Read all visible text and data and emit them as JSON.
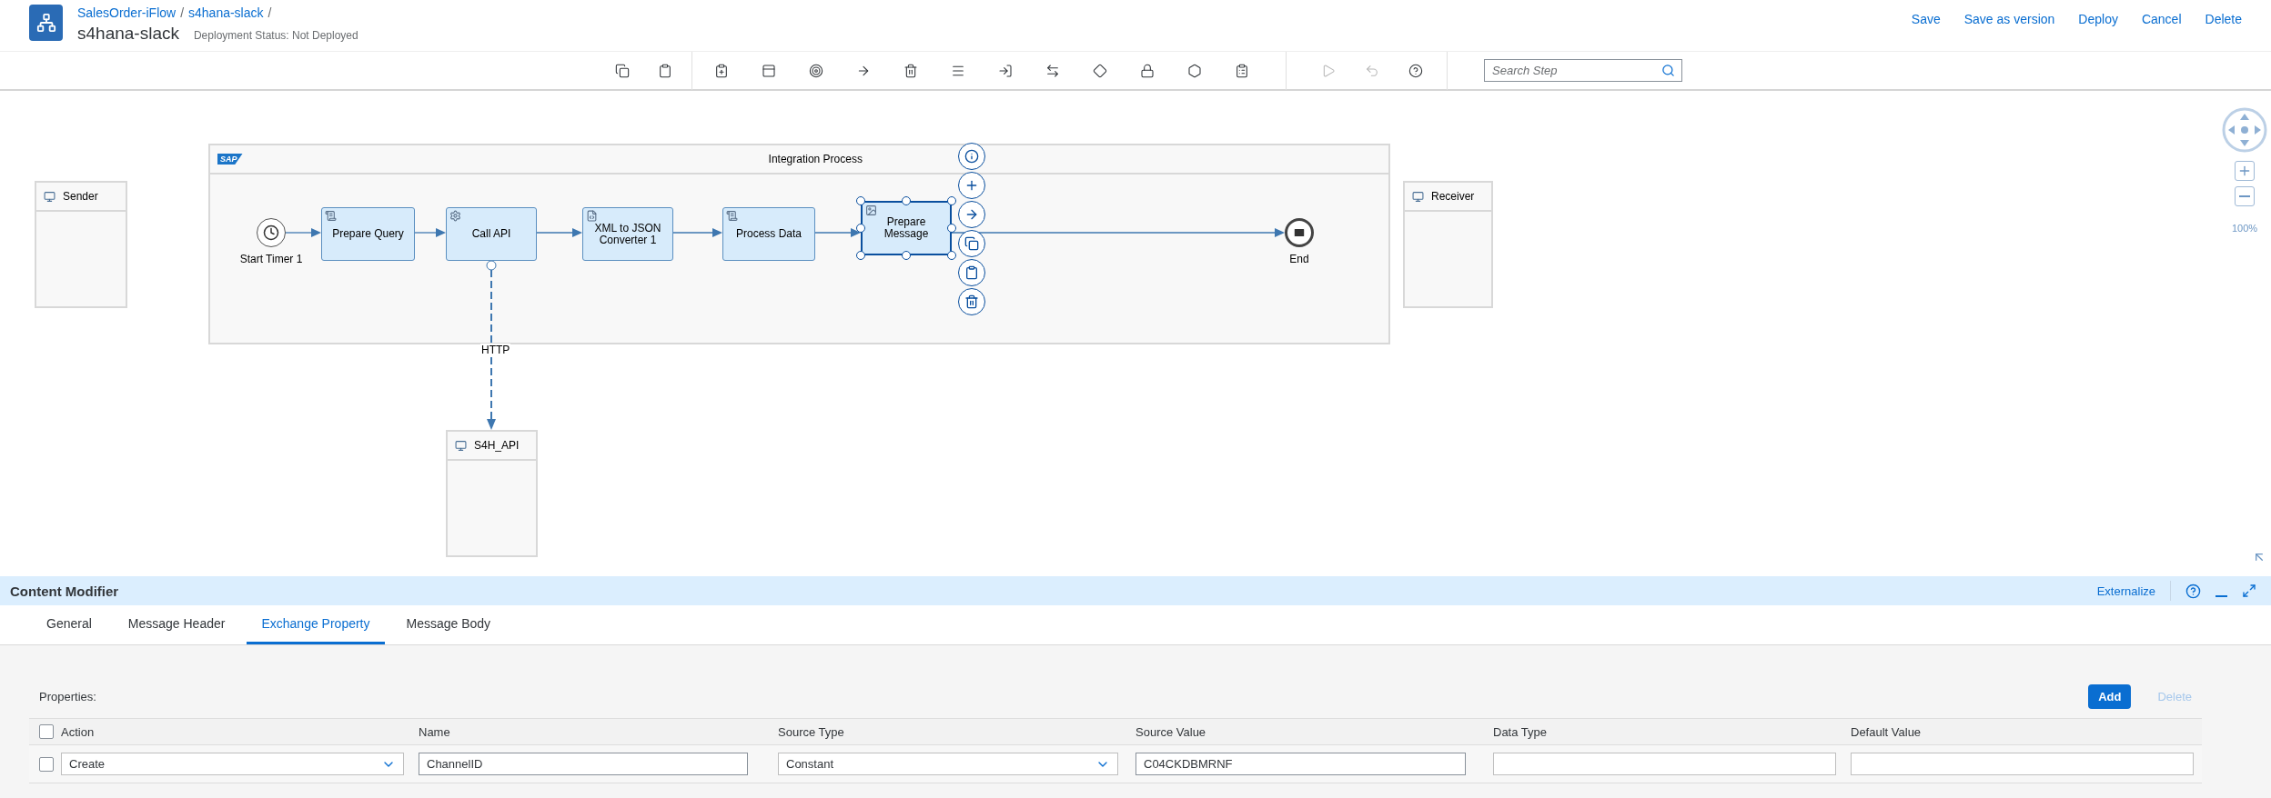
{
  "header": {
    "breadcrumbs": [
      "SalesOrder-iFlow",
      "s4hana-slack"
    ],
    "separator": "/",
    "title": "s4hana-slack",
    "status": "Deployment Status: Not Deployed",
    "actions": [
      "Save",
      "Save as version",
      "Deploy",
      "Cancel",
      "Delete"
    ]
  },
  "toolbar": {
    "tools": [
      {
        "disabled": false
      },
      {
        "disabled": false
      },
      {
        "disabled": false
      },
      {
        "disabled": false
      },
      {
        "disabled": false
      },
      {
        "disabled": false
      },
      {
        "disabled": false
      },
      {
        "disabled": false
      },
      {
        "disabled": false
      },
      {
        "disabled": false
      },
      {
        "disabled": false
      },
      {
        "disabled": false
      },
      {
        "disabled": false
      },
      {
        "disabled": false
      },
      {
        "disabled": true
      },
      {
        "disabled": true
      },
      {
        "disabled": false
      }
    ],
    "search": {
      "placeholder": "Search Step"
    }
  },
  "canvas": {
    "participants": [
      {
        "name": "Sender"
      },
      {
        "name": "Receiver"
      },
      {
        "name": "S4H_API"
      }
    ],
    "process": {
      "title": "Integration Process",
      "logo": "SAP",
      "steps": [
        {
          "kind": "timer",
          "label": "Start Timer 1",
          "selected": false
        },
        {
          "kind": "script",
          "label": "Prepare Query",
          "selected": false
        },
        {
          "kind": "service",
          "label": "Call API",
          "selected": false
        },
        {
          "kind": "converter",
          "label": "XML to JSON Converter 1",
          "selected": false
        },
        {
          "kind": "script",
          "label": "Process Data",
          "selected": false
        },
        {
          "kind": "modifier",
          "label": "Prepare Message",
          "selected": true
        },
        {
          "kind": "end",
          "label": "End",
          "selected": false
        }
      ]
    },
    "connection": {
      "label": "HTTP"
    },
    "zoom": "100%"
  },
  "panel": {
    "title": "Content Modifier",
    "actions": [
      "Externalize"
    ],
    "tabs": [
      {
        "label": "General",
        "selected": false
      },
      {
        "label": "Message Header",
        "selected": false
      },
      {
        "label": "Exchange Property",
        "selected": true
      },
      {
        "label": "Message Body",
        "selected": false
      }
    ],
    "properties_label": "Properties:",
    "buttons": [
      {
        "label": "Add",
        "disabled": false
      },
      {
        "label": "Delete",
        "disabled": true
      }
    ],
    "table": {
      "columns": [
        "Action",
        "Name",
        "Source Type",
        "Source Value",
        "Data Type",
        "Default Value"
      ],
      "all_checked": false,
      "rows": [
        {
          "checked": false,
          "action": "Create",
          "name": "ChannelID",
          "source_type": "Constant",
          "source_value": "C04CKDBMRNF"
        }
      ]
    }
  }
}
